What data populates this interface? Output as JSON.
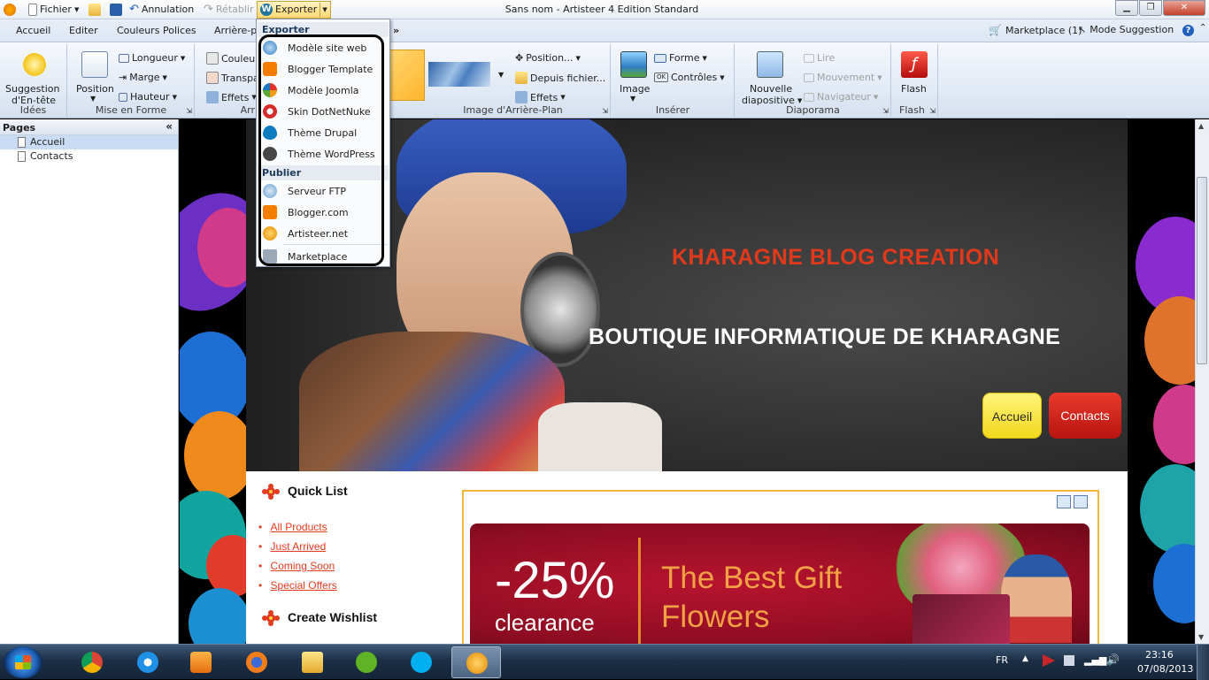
{
  "window": {
    "title": "Sans nom - Artisteer 4 Edition Standard",
    "quick_access": [
      "Fichier",
      "Annulation",
      "Rétablir",
      "Exporter"
    ]
  },
  "tabs": [
    "Accueil",
    "Editer",
    "Couleurs",
    "Polices",
    "Arrière-p"
  ],
  "tabs_right": {
    "marketplace": "Marketplace (1)",
    "suggestion": "Mode Suggestion"
  },
  "ribbon": {
    "idees": {
      "btn": "Suggestion",
      "btn2": "d'En-tête",
      "label": "Idées"
    },
    "mise_en_forme": {
      "position": "Position",
      "longueur": "Longueur",
      "marge": "Marge",
      "hauteur": "Hauteur",
      "label": "Mise en Forme"
    },
    "arr": {
      "couleur": "Couleu",
      "transp": "Transpa",
      "effets": "Effets",
      "label": "Arr"
    },
    "image_arriere": {
      "position": "Position...",
      "depuis": "Depuis fichier...",
      "effets": "Effets",
      "label": "Image d'Arrière-Plan"
    },
    "inserer": {
      "image": "Image",
      "forme": "Forme",
      "controles": "Contrôles",
      "label": "Insérer"
    },
    "diaporama": {
      "nouvelle": "Nouvelle",
      "diapositive": "diapositive",
      "lire": "Lire",
      "mouvement": "Mouvement",
      "navigateur": "Navigateur",
      "label": "Diaporama"
    },
    "flash": {
      "btn": "Flash",
      "label": "Flash"
    }
  },
  "pages_panel": {
    "title": "Pages",
    "items": [
      "Accueil",
      "Contacts"
    ]
  },
  "export_menu": {
    "head1": "Exporter",
    "items1": [
      "Modèle site web",
      "Blogger Template",
      "Modèle Joomla",
      "Skin DotNetNuke",
      "Thème Drupal",
      "Thème WordPress"
    ],
    "head2": "Publier",
    "items2": [
      "Serveur FTP",
      "Blogger.com",
      "Artisteer.net",
      "Marketplace"
    ]
  },
  "site": {
    "title": "KHARAGNE BLOG CREATION",
    "slogan": "BOUTIQUE INFORMATIQUE DE KHARAGNE",
    "nav": [
      "Accueil",
      "Contacts"
    ],
    "quick_list_title": "Quick List",
    "quick_list": [
      "All Products",
      "Just Arrived",
      "Coming Soon",
      "Special Offers"
    ],
    "wishlist_title": "Create Wishlist",
    "banner": {
      "discount": "-25%",
      "clearance": "clearance",
      "line1": "The Best Gift",
      "line2": "Flowers"
    }
  },
  "taskbar": {
    "lang": "FR",
    "time": "23:16",
    "date": "07/08/2013"
  },
  "colors": {
    "accent": "#2b579a",
    "title_red": "#e0391c",
    "nav_yellow": "#f5e52a",
    "nav_red": "#d0211a",
    "banner": "#9e0f24"
  }
}
